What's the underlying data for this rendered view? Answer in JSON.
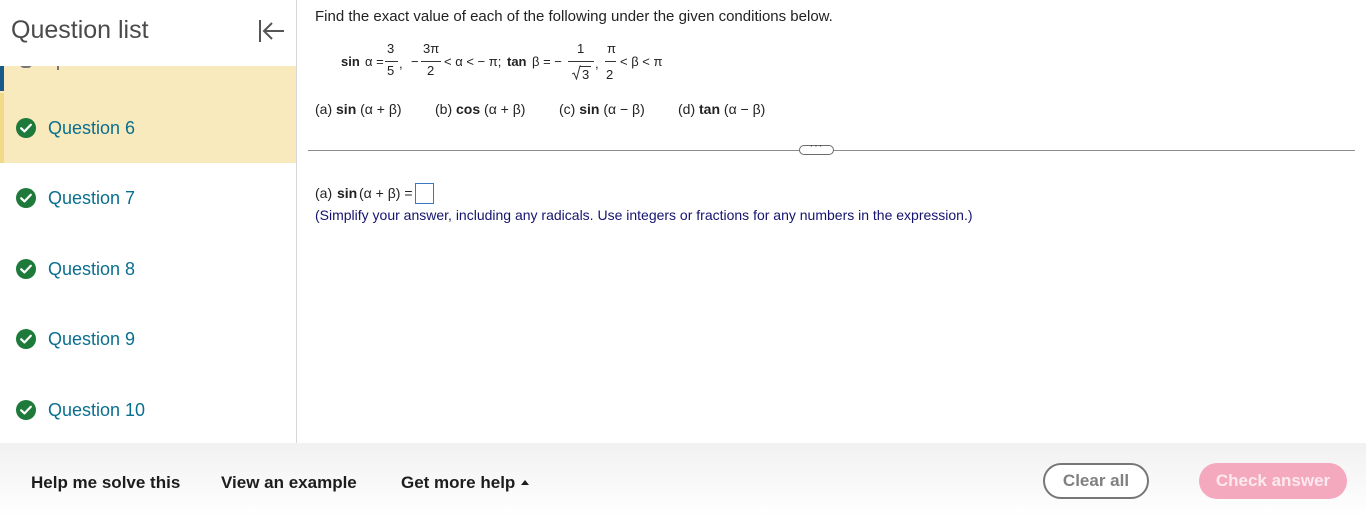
{
  "sidebar": {
    "title": "Question list",
    "questions": [
      {
        "label": "Question 6",
        "status": "complete",
        "current": true
      },
      {
        "label": "Question 7",
        "status": "complete",
        "current": false
      },
      {
        "label": "Question 8",
        "status": "complete",
        "current": false
      },
      {
        "label": "Question 9",
        "status": "complete",
        "current": false
      },
      {
        "label": "Question 10",
        "status": "complete",
        "current": false
      }
    ]
  },
  "question": {
    "instruction": "Find the exact value of each of the following under the given conditions below.",
    "given": {
      "sin_lhs": "sin",
      "alpha_eq": "α =",
      "frac1_num": "3",
      "frac1_den": "5",
      "comma": ",",
      "minus": "−",
      "frac2_num": "3π",
      "frac2_den": "2",
      "alpha_range": "< α < − π;",
      "tan_lhs": "tan",
      "beta_eq": "β = −",
      "frac3_num": "1",
      "frac3_den": "3",
      "frac4_num": "π",
      "frac4_den": "2",
      "beta_range": "< β < π"
    },
    "parts": [
      {
        "prefix": "(a)",
        "func": "sin",
        "arg": "(α + β)"
      },
      {
        "prefix": "(b)",
        "func": "cos",
        "arg": "(α + β)"
      },
      {
        "prefix": "(c)",
        "func": "sin",
        "arg": "(α − β)"
      },
      {
        "prefix": "(d)",
        "func": "tan",
        "arg": "(α − β)"
      }
    ],
    "divider_dots": "···",
    "answer": {
      "prefix": "(a)",
      "func": "sin",
      "arg": "(α + β) =",
      "value": ""
    },
    "hint": "(Simplify your answer, including any radicals. Use integers or fractions for any numbers in the expression.)"
  },
  "footer": {
    "help_solve": "Help me solve this",
    "view_example": "View an example",
    "more_help": "Get more help",
    "clear_all": "Clear all",
    "check_answer": "Check answer"
  },
  "colors": {
    "current_bg": "#f8eabd",
    "link": "#0a6f8f",
    "check_green": "#1e7a3a",
    "check_btn": "#f4a9bf"
  },
  "icons": {
    "collapse": "collapse-left-icon",
    "check": "check-circle-icon",
    "more_help_caret": "caret-up-icon"
  }
}
